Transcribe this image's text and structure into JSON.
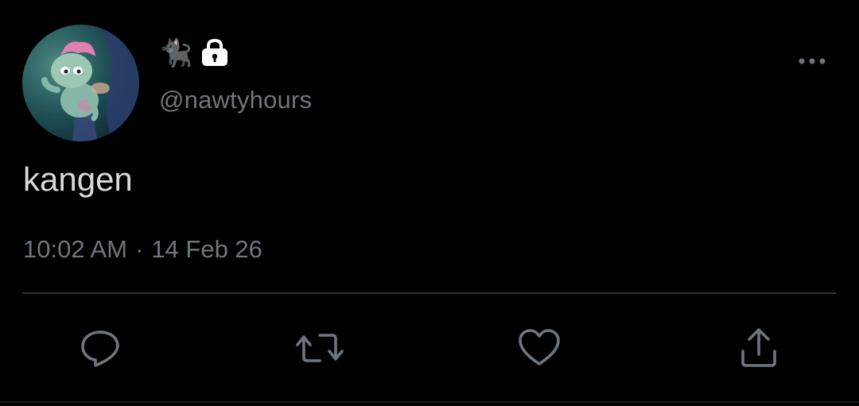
{
  "author": {
    "display_name_emoji": "🐈‍⬛",
    "protected_badge": "lock-icon",
    "handle": "@nawtyhours",
    "avatar": "avatar-photo"
  },
  "tweet": {
    "text": "kangen",
    "time": "10:02 AM",
    "separator": "·",
    "date": "14 Feb 26"
  },
  "actions": [
    {
      "icon": "reply-icon"
    },
    {
      "icon": "retweet-icon"
    },
    {
      "icon": "like-icon"
    },
    {
      "icon": "share-icon"
    }
  ],
  "colors": {
    "background": "#000000",
    "primary_text": "#d9d9d9",
    "secondary_text": "#6e767d",
    "divider": "#2f3336"
  }
}
